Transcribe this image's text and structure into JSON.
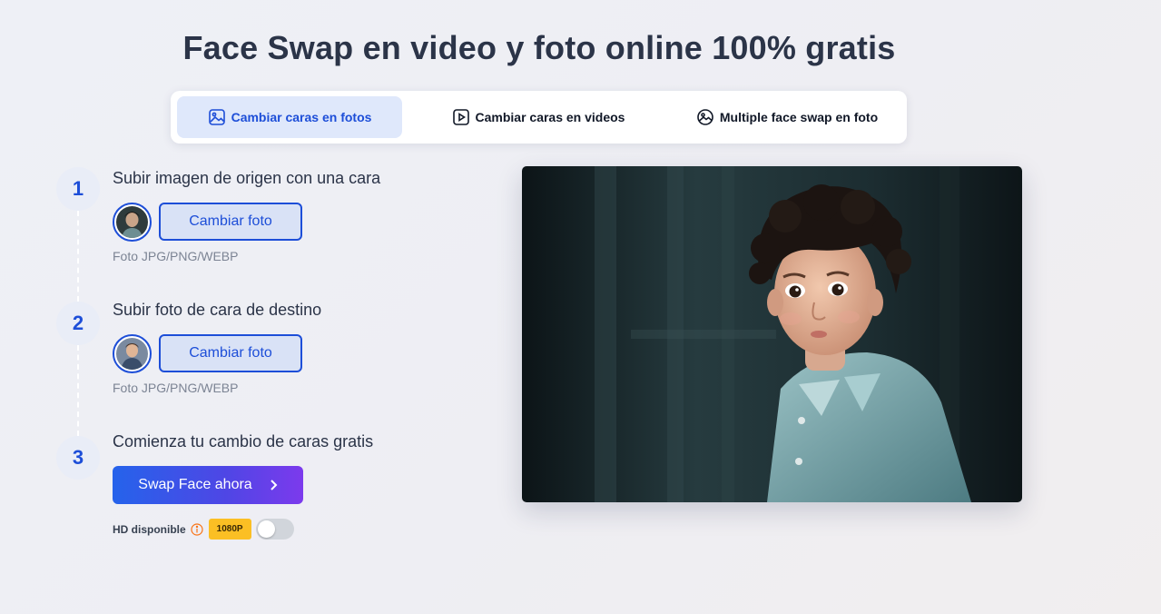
{
  "page": {
    "title": "Face Swap en video y foto online 100% gratis"
  },
  "tabs": [
    {
      "label": "Cambiar caras en fotos",
      "icon": "image-icon",
      "active": true
    },
    {
      "label": "Cambiar caras en videos",
      "icon": "play-square-icon",
      "active": false
    },
    {
      "label": "Multiple face swap en foto",
      "icon": "multi-face-image-icon",
      "active": false
    }
  ],
  "steps": [
    {
      "number": "1",
      "title": "Subir imagen de origen con una cara",
      "button": "Cambiar foto",
      "formats": "Foto JPG/PNG/WEBP",
      "thumbnail": "source-face-thumbnail"
    },
    {
      "number": "2",
      "title": "Subir foto de cara de destino",
      "button": "Cambiar foto",
      "formats": "Foto JPG/PNG/WEBP",
      "thumbnail": "target-face-thumbnail"
    },
    {
      "number": "3",
      "title": "Comienza tu cambio de caras gratis",
      "button": "Swap Face ahora"
    }
  ],
  "hd": {
    "label": "HD disponible",
    "badge": "1080P",
    "enabled": false
  },
  "colors": {
    "accent": "#1d4ed8",
    "tab_active_bg": "#dfe8fb",
    "badge_bg": "#fbbf24",
    "info_icon": "#f97316"
  }
}
